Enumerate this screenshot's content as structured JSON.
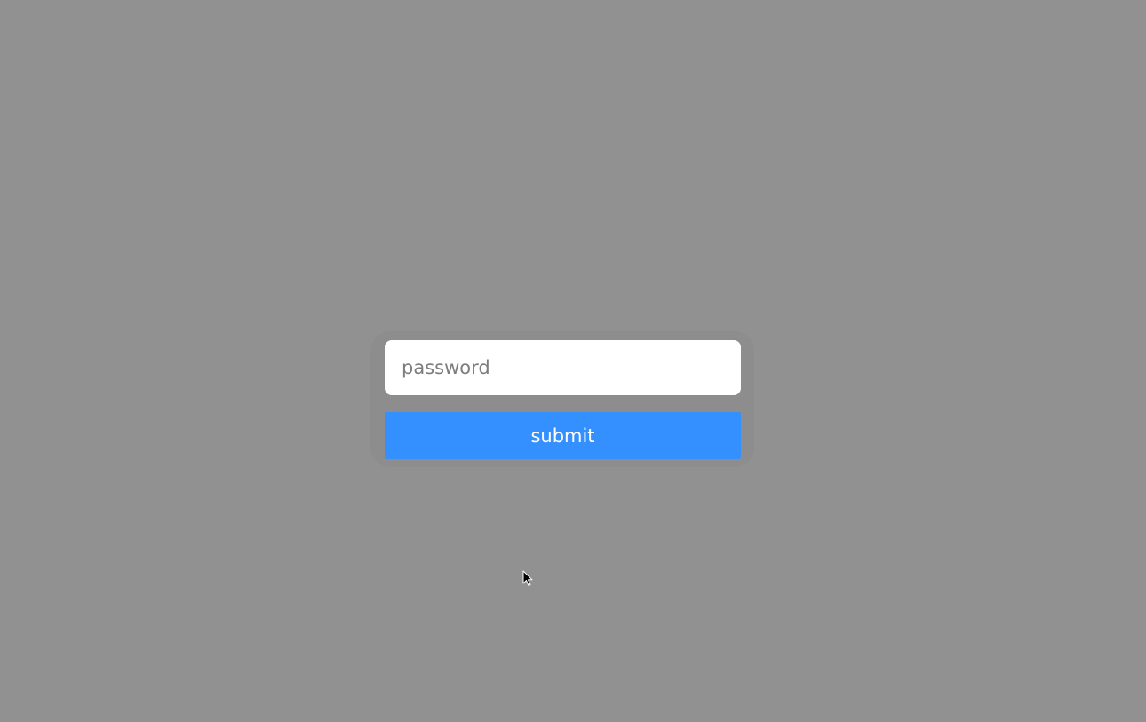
{
  "login_form": {
    "password_field": {
      "value": "",
      "placeholder": "password"
    },
    "submit_label": "submit"
  },
  "colors": {
    "background": "#919191",
    "panel": "#8d8d8d",
    "submit_button": "#3490ff",
    "input_background": "#ffffff"
  },
  "icons": {
    "mouse_cursor": "cursor-icon"
  }
}
